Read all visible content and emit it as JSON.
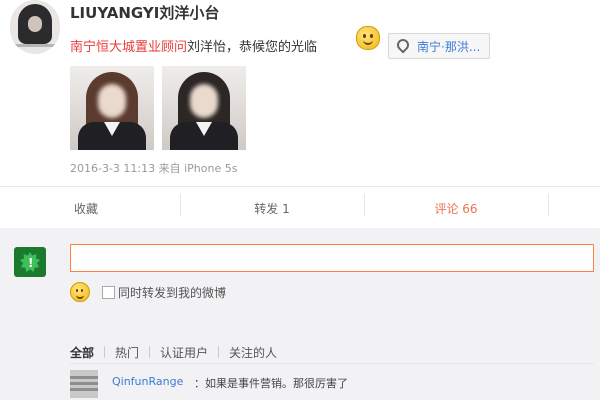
{
  "post": {
    "username": "LIUYANGYI刘洋小台",
    "text_highlight": "南宁恒大城置业顾问",
    "text_rest": "刘洋怡，恭候您的光临",
    "location": "南宁·那洪...",
    "meta": "2016-3-3 11:13 来自 iPhone 5s"
  },
  "actions": {
    "favorite": "收藏",
    "repost": "转发 1",
    "comment": "评论 66"
  },
  "composer": {
    "input_value": "",
    "repost_checkbox_label": "同时转发到我的微博"
  },
  "filters": [
    "全部",
    "热门",
    "认证用户",
    "关注的人"
  ],
  "comments": [
    {
      "user": "QinfunRange",
      "text": "：如果是事件营销。那很厉害了"
    }
  ],
  "colors": {
    "highlight": "#eb3b3b",
    "comment_accent": "#eb7350",
    "input_border": "#ff8140",
    "link": "#3a7bd5"
  },
  "icons": [
    "avatar",
    "smiley-icon",
    "location-pin-icon",
    "user-avatar-icon",
    "emoji-icon",
    "checkbox"
  ]
}
